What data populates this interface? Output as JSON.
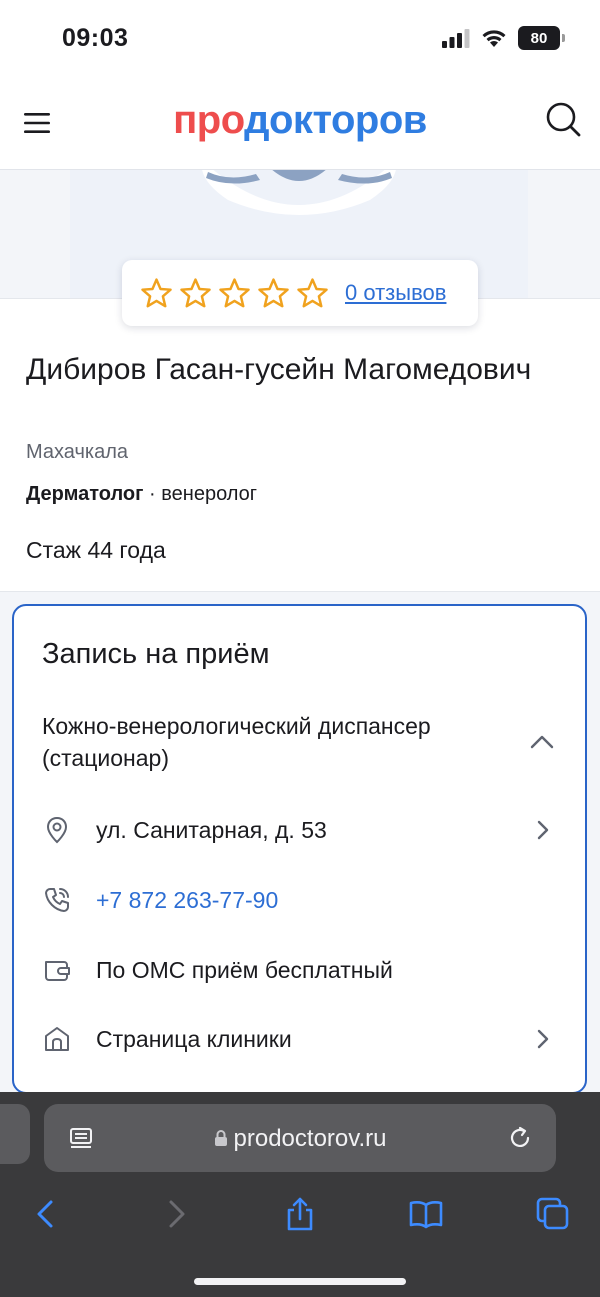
{
  "status_bar": {
    "time": "09:03",
    "battery": "80"
  },
  "header": {
    "logo_part1": "про",
    "logo_part2": "докторов"
  },
  "rating": {
    "stars_filled": 0,
    "stars_total": 5,
    "reviews_link": "0 отзывов"
  },
  "doctor": {
    "name": "Дибиров Гасан-гусейн Магомедович",
    "city": "Махачкала",
    "specialty_main": "Дерматолог",
    "specialty_separator": " · ",
    "specialty_other": "венеролог",
    "experience": "Стаж 44 года"
  },
  "appointment": {
    "title": "Запись на приём",
    "clinic_name": "Кожно-венерологический диспансер (стационар)",
    "address": "ул. Санитарная, д. 53",
    "phone": "+7 872 263-77-90",
    "oms_note": "По ОМС приём бесплатный",
    "clinic_page": "Страница клиники"
  },
  "browser": {
    "url": "prodoctorov.ru"
  },
  "colors": {
    "accent_blue": "#2a64c8",
    "link_blue": "#2d6ed4",
    "logo_red": "#ee4d4d",
    "logo_blue": "#2f7de1",
    "star_gold": "#f0a21e"
  }
}
